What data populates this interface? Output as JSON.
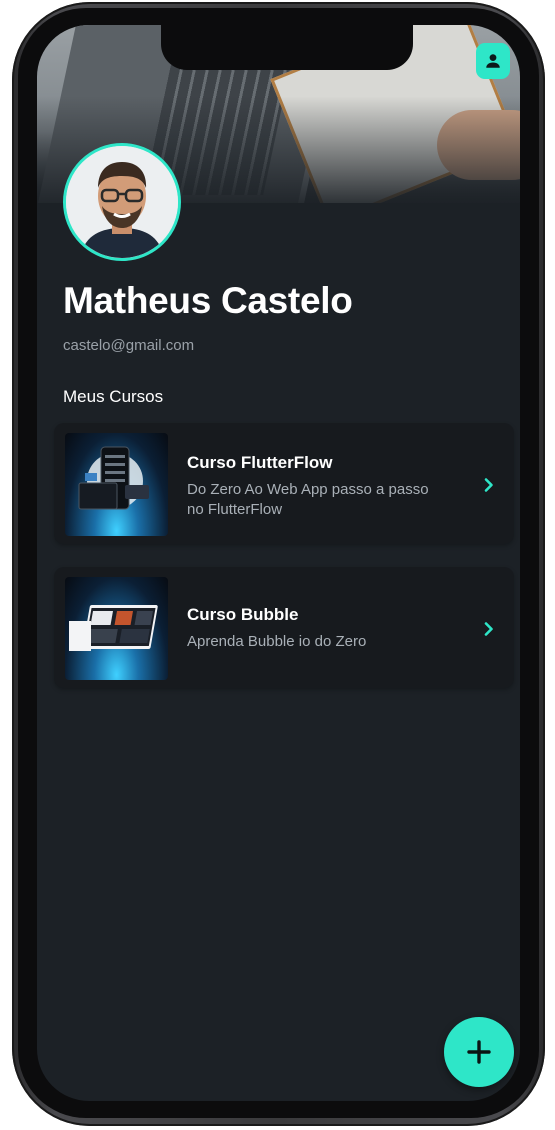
{
  "profile": {
    "name": "Matheus Castelo",
    "email": "castelo@gmail.com"
  },
  "section": {
    "title": "Meus Cursos"
  },
  "courses": [
    {
      "title": "Curso FlutterFlow",
      "subtitle": "Do Zero Ao Web App passo a passo no FlutterFlow",
      "chevron_icon": "chevron-right-icon"
    },
    {
      "title": "Curso Bubble",
      "subtitle": "Aprenda Bubble io do Zero",
      "chevron_icon": "chevron-right-icon"
    }
  ],
  "icons": {
    "profile": "person-icon",
    "fab": "plus-icon"
  },
  "colors": {
    "accent": "#2ee6c8",
    "background": "#1c2126",
    "card": "#171a1e",
    "text_primary": "#ffffff",
    "text_secondary": "#9aa1a8"
  }
}
